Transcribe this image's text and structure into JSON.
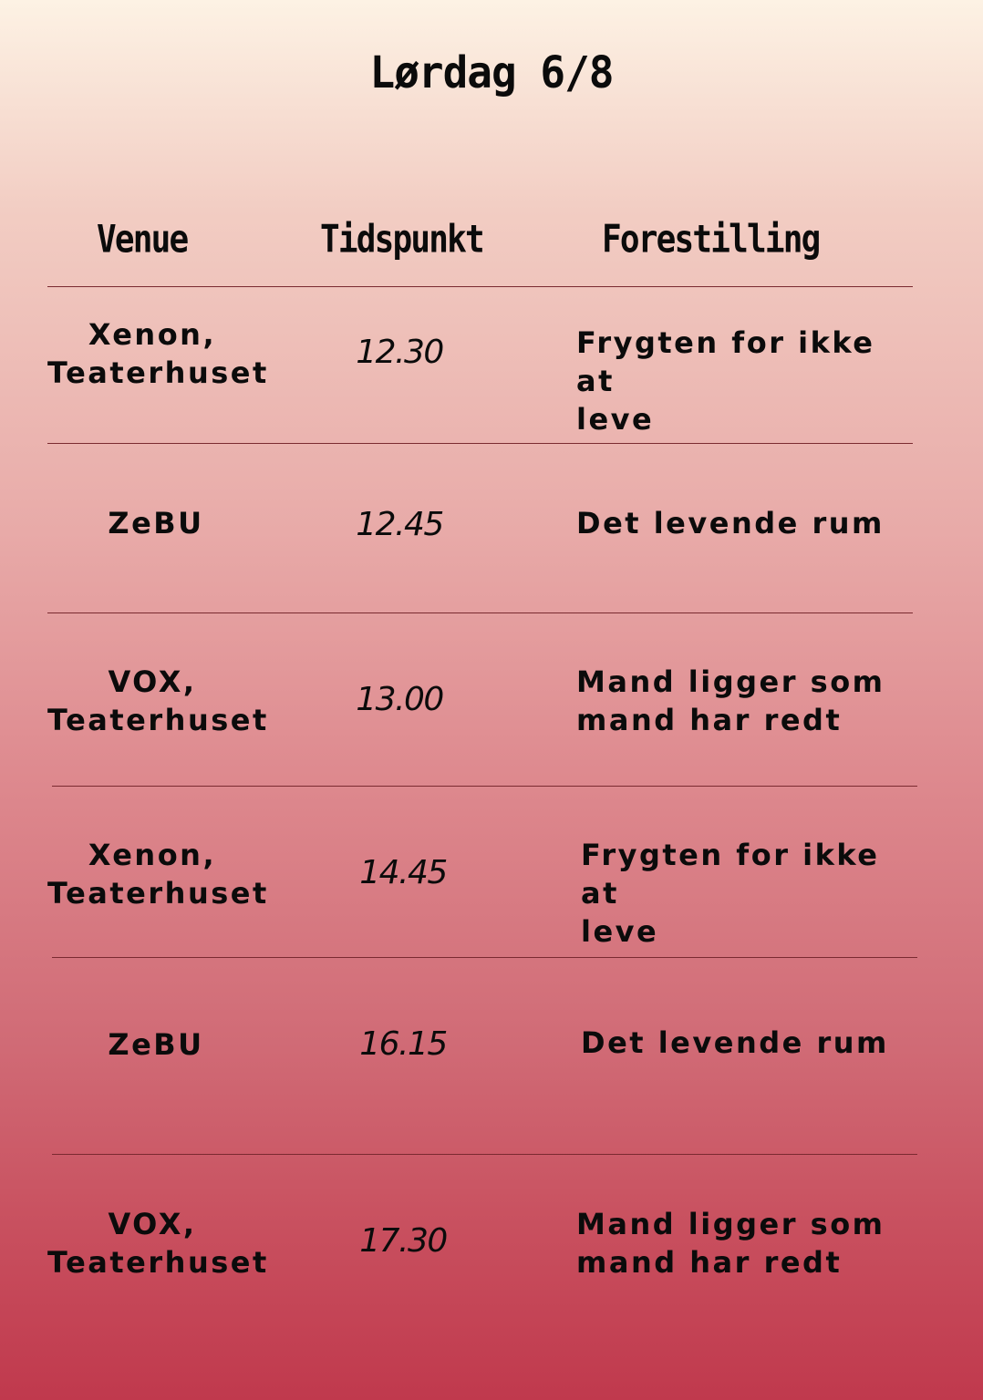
{
  "title": "Lørdag 6/8",
  "headers": {
    "venue": "Venue",
    "time": "Tidspunkt",
    "show": "Forestilling"
  },
  "rows": [
    {
      "venue": "Xenon,\nTeaterhuset",
      "time": "12.30",
      "show": "Frygten for ikke at\nleve"
    },
    {
      "venue": "ZeBU",
      "time": "12.45",
      "show": "Det levende rum"
    },
    {
      "venue": "VOX,\nTeaterhuset",
      "time": "13.00",
      "show": "Mand ligger som\nmand har redt"
    },
    {
      "venue": "Xenon,\nTeaterhuset",
      "time": "14.45",
      "show": "Frygten for ikke at\nleve"
    },
    {
      "venue": "ZeBU",
      "time": "16.15",
      "show": "Det levende rum"
    },
    {
      "venue": "VOX,\nTeaterhuset",
      "time": "17.30",
      "show": "Mand ligger som\nmand har redt"
    }
  ]
}
